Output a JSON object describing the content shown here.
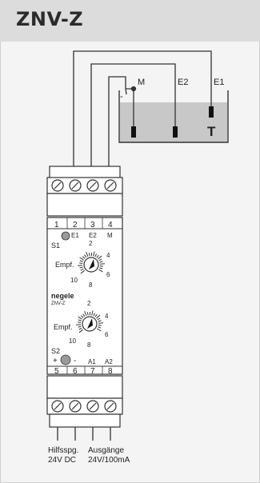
{
  "header": {
    "title": "ZNV-Z"
  },
  "tank": {
    "label": "T",
    "probes": {
      "m": "M",
      "e2": "E2",
      "e1": "E1"
    },
    "fill_fraction": 0.72,
    "colors": {
      "liquid": "#c8c8c8",
      "wire": "#333333"
    }
  },
  "terminals_top": [
    "1",
    "2",
    "3",
    "4"
  ],
  "terminal_top_labels": [
    "E1",
    "E2",
    "M"
  ],
  "terminals_bottom": [
    "5",
    "6",
    "7",
    "8"
  ],
  "terminal_bottom_labels": [
    "A1",
    "A2"
  ],
  "device": {
    "s1_label": "S1",
    "s2_label": "S2",
    "s2_plus": "+",
    "s2_minus": "-",
    "dial1_label": "Empf.",
    "dial2_label": "Empf.",
    "dial_ticks": [
      "2",
      "4",
      "6",
      "8",
      "10"
    ],
    "brand": "negele",
    "model": "ZNV-Z",
    "probe_minus": "-"
  },
  "bottom_labels": {
    "supply_line1": "Hilfsspg.",
    "supply_line2": "24V DC",
    "output_line1": "Ausgänge",
    "output_line2": "24V/100mA"
  }
}
